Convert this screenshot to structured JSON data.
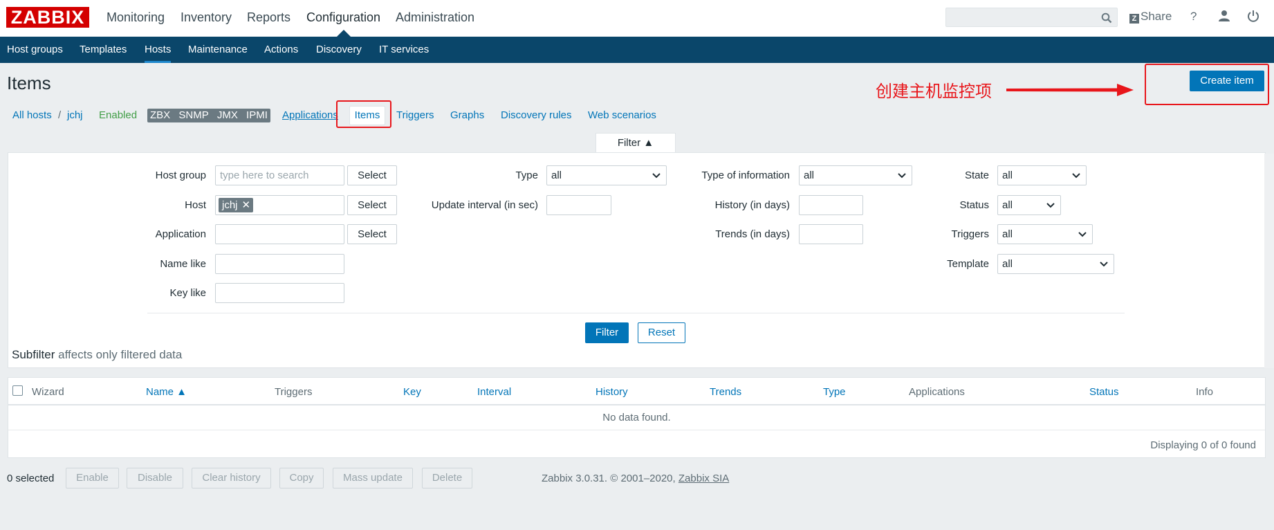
{
  "header": {
    "logo": "ZABBIX",
    "main_menu": [
      {
        "label": "Monitoring"
      },
      {
        "label": "Inventory"
      },
      {
        "label": "Reports"
      },
      {
        "label": "Configuration",
        "active": true
      },
      {
        "label": "Administration"
      }
    ],
    "share_label": "Share",
    "help_label": "?"
  },
  "submenu": [
    {
      "label": "Host groups"
    },
    {
      "label": "Templates"
    },
    {
      "label": "Hosts",
      "active": true
    },
    {
      "label": "Maintenance"
    },
    {
      "label": "Actions"
    },
    {
      "label": "Discovery"
    },
    {
      "label": "IT services"
    }
  ],
  "page": {
    "title": "Items",
    "create_button": "Create item",
    "annotation": "创建主机监控项"
  },
  "breadcrumb": {
    "all_hosts": "All hosts",
    "separator": "/",
    "host": "jchj",
    "status": "Enabled",
    "badges": [
      "ZBX",
      "SNMP",
      "JMX",
      "IPMI"
    ],
    "tabs": {
      "applications": "Applications",
      "items": "Items",
      "triggers": "Triggers",
      "graphs": "Graphs",
      "discovery": "Discovery rules",
      "web": "Web scenarios"
    }
  },
  "filter": {
    "tab_label": "Filter ▲",
    "host_group": {
      "label": "Host group",
      "placeholder": "type here to search",
      "button": "Select"
    },
    "host": {
      "label": "Host",
      "tag": "jchj",
      "button": "Select"
    },
    "application": {
      "label": "Application",
      "button": "Select"
    },
    "name_like": {
      "label": "Name like"
    },
    "key_like": {
      "label": "Key like"
    },
    "type": {
      "label": "Type",
      "value": "all"
    },
    "update_interval": {
      "label": "Update interval (in sec)"
    },
    "type_of_information": {
      "label": "Type of information",
      "value": "all"
    },
    "history": {
      "label": "History (in days)"
    },
    "trends": {
      "label": "Trends (in days)"
    },
    "state": {
      "label": "State",
      "value": "all"
    },
    "status": {
      "label": "Status",
      "value": "all"
    },
    "triggers": {
      "label": "Triggers",
      "value": "all"
    },
    "template": {
      "label": "Template",
      "value": "all"
    },
    "filter_button": "Filter",
    "reset_button": "Reset"
  },
  "subfilter": {
    "title": "Subfilter",
    "note": "affects only filtered data"
  },
  "table": {
    "columns": {
      "wizard": "Wizard",
      "name": "Name ▲",
      "triggers": "Triggers",
      "key": "Key",
      "interval": "Interval",
      "history": "History",
      "trends": "Trends",
      "type": "Type",
      "applications": "Applications",
      "status": "Status",
      "info": "Info"
    },
    "empty": "No data found.",
    "displaying": "Displaying 0 of 0 found"
  },
  "bottom": {
    "selected": "0 selected",
    "buttons": [
      "Enable",
      "Disable",
      "Clear history",
      "Copy",
      "Mass update",
      "Delete"
    ],
    "footer_text": "Zabbix 3.0.31. © 2001–2020,",
    "footer_link": "Zabbix SIA"
  },
  "colors": {
    "brand": "#d40000",
    "nav": "#0a466a",
    "accent": "#0275b8",
    "annotation": "#e8161b"
  }
}
